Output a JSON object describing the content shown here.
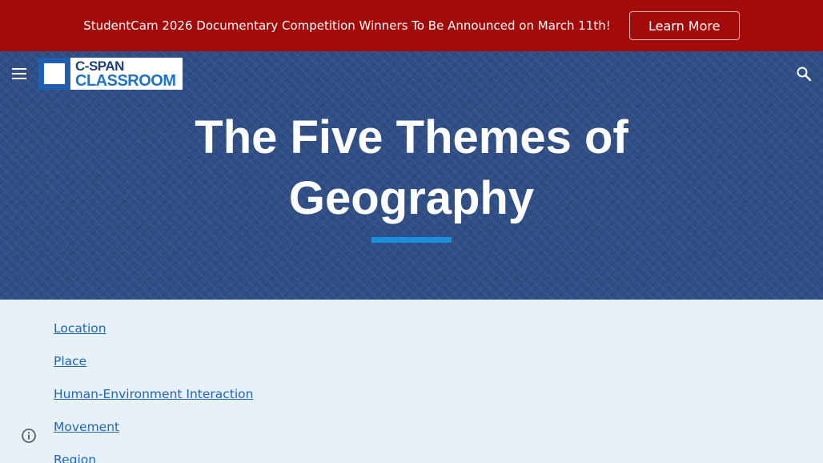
{
  "banner": {
    "text": "StudentCam 2026 Documentary Competition Winners To Be Announced on March 11th!",
    "button_label": "Learn More"
  },
  "header": {
    "logo_line1": "C-SPAN",
    "logo_line2": "CLASSROOM",
    "menu_icon": "menu-icon",
    "search_icon": "search-icon"
  },
  "hero": {
    "title": "The Five Themes of Geography"
  },
  "content": {
    "links": [
      "Location",
      "Place",
      "Human-Environment Interaction",
      "Movement",
      "Region"
    ]
  },
  "footer": {
    "info_icon": "info-icon"
  },
  "colors": {
    "banner": "#a30b0b",
    "hero": "#2f4f86",
    "accent": "#1a8fe0",
    "link": "#1f65b5",
    "page_bg": "#e9f1f8"
  }
}
